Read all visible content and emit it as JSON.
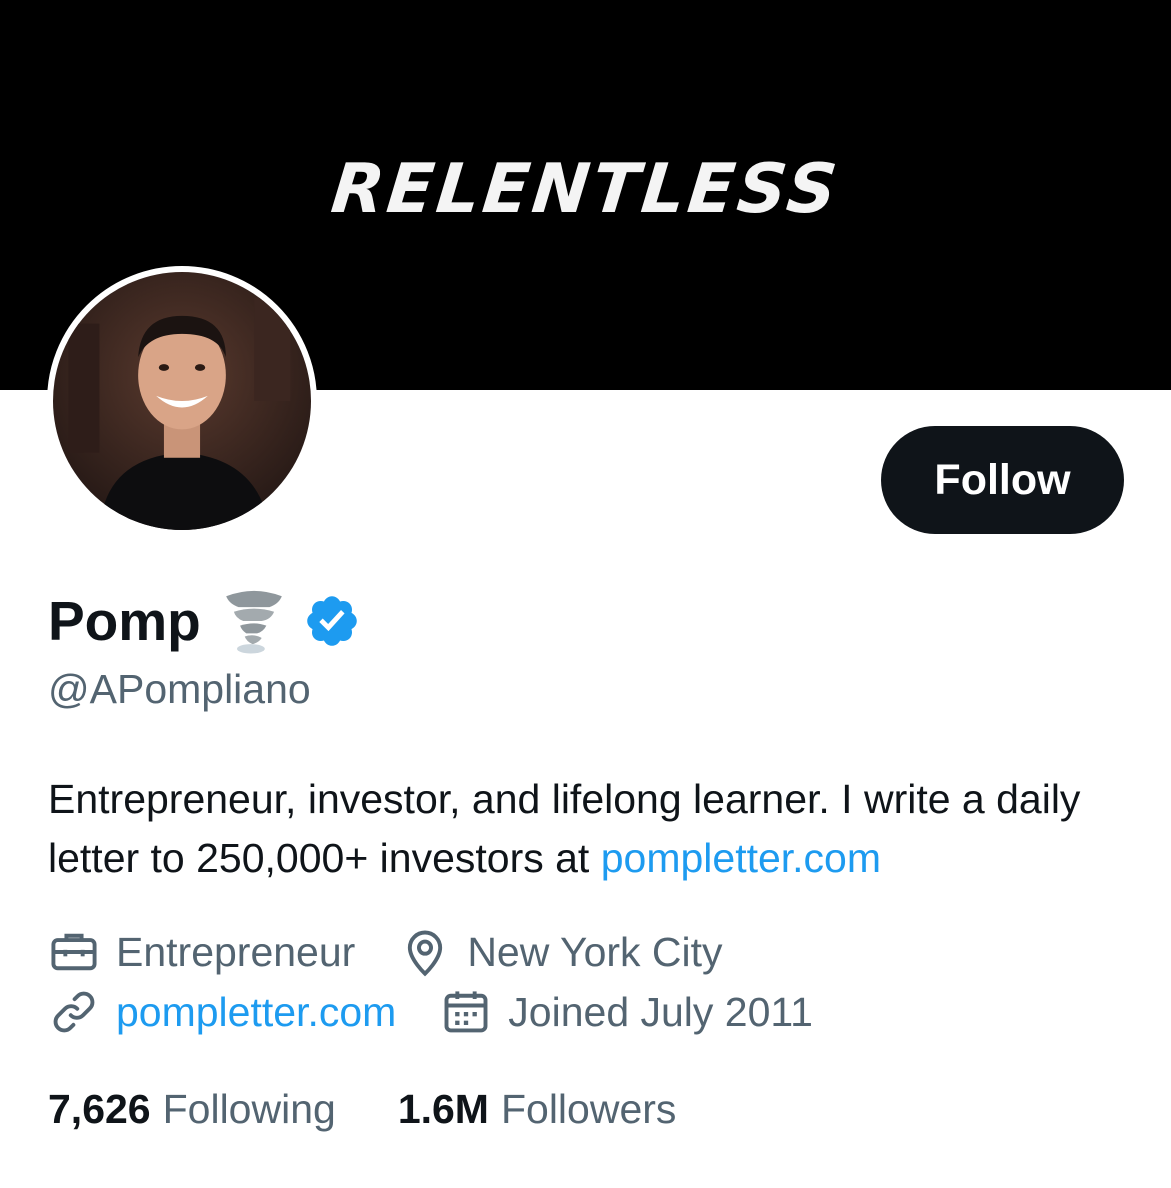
{
  "banner": {
    "text": "RELENTLESS"
  },
  "profile": {
    "display_name": "Pomp",
    "handle": "@APompliano",
    "follow_label": "Follow",
    "bio_text": "Entrepreneur, investor, and lifelong learner. I write a daily letter to 250,000+ investors at",
    "bio_link": "pompletter.com",
    "profession": "Entrepreneur",
    "location": "New York City",
    "website": "pompletter.com",
    "joined": "Joined July 2011"
  },
  "stats": {
    "following_count": "7,626",
    "following_label": "Following",
    "followers_count": "1.6M",
    "followers_label": "Followers"
  },
  "icons": [
    "tornado-emoji",
    "verified-badge",
    "briefcase",
    "location-pin",
    "link",
    "calendar"
  ],
  "colors": {
    "text": "#0f1419",
    "secondary": "#536471",
    "accent": "#1d9bf0",
    "button": "#0f1419",
    "banner": "#000000"
  }
}
